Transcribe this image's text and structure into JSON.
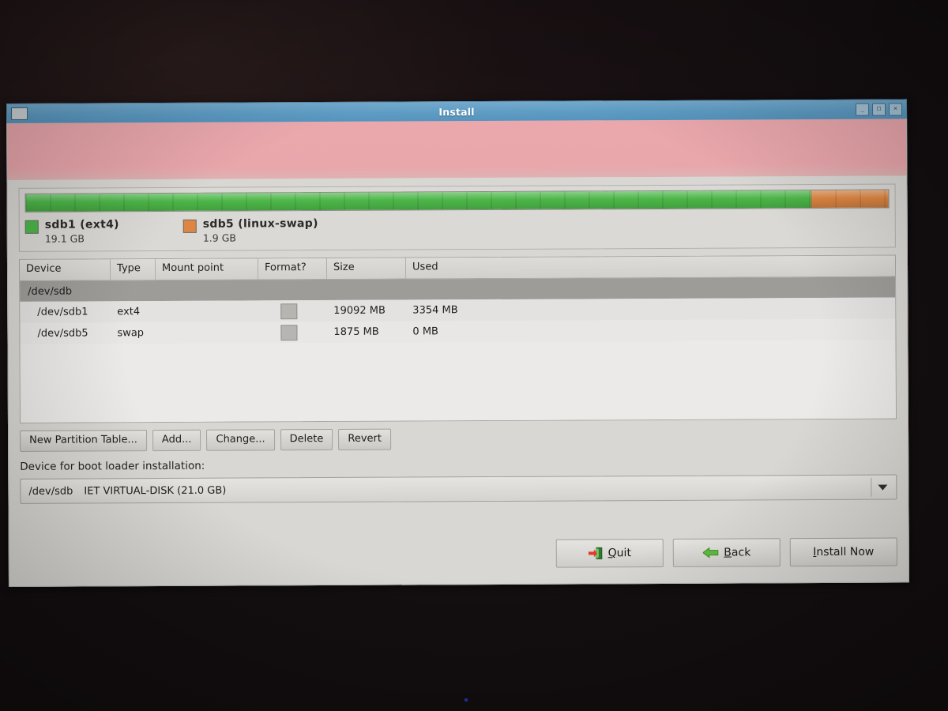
{
  "window": {
    "title": "Install",
    "menu_icon": "window-menu-icon",
    "buttons": [
      {
        "name": "minimize",
        "glyph": "_"
      },
      {
        "name": "maximize",
        "glyph": "□"
      },
      {
        "name": "close",
        "glyph": "✕"
      }
    ]
  },
  "partition_bar": {
    "segments": [
      {
        "label": "sdb1 (ext4)",
        "size_text": "19.1 GB",
        "color": "#4cb648",
        "percent": 91.0
      },
      {
        "label": "sdb5 (linux-swap)",
        "size_text": "1.9 GB",
        "color": "#dd8643",
        "percent": 9.0
      }
    ]
  },
  "table": {
    "columns": [
      "Device",
      "Type",
      "Mount point",
      "Format?",
      "Size",
      "Used"
    ],
    "groups": [
      {
        "label": "/dev/sdb",
        "rows": [
          {
            "device": "/dev/sdb1",
            "type": "ext4",
            "mount": "",
            "format": false,
            "size": "19092 MB",
            "used": "3354 MB"
          },
          {
            "device": "/dev/sdb5",
            "type": "swap",
            "mount": "",
            "format": false,
            "size": "1875 MB",
            "used": "0 MB"
          }
        ]
      }
    ]
  },
  "partition_actions": [
    {
      "name": "new-partition-table",
      "label": "New Partition Table..."
    },
    {
      "name": "add",
      "label": "Add..."
    },
    {
      "name": "change",
      "label": "Change..."
    },
    {
      "name": "delete",
      "label": "Delete"
    },
    {
      "name": "revert",
      "label": "Revert"
    }
  ],
  "bootloader": {
    "label": "Device for boot loader installation:",
    "selected_device": "/dev/sdb",
    "selected_description": "IET VIRTUAL-DISK (21.0 GB)",
    "arrow_icon": "chevron-down-icon"
  },
  "footer": {
    "quit": {
      "label_pre": "",
      "mnemonic": "Q",
      "label_post": "uit",
      "icon": "quit-door-icon"
    },
    "back": {
      "label_pre": "",
      "mnemonic": "B",
      "label_post": "ack",
      "icon": "arrow-left-icon"
    },
    "install": {
      "mnemonic": "I",
      "label_post": "nstall Now"
    }
  },
  "colors": {
    "titlebar": "#5e9cc4",
    "empty_canvas": "#e9a6ab",
    "window_bg": "#d9d7d3",
    "ext4_green": "#4cb648",
    "swap_orange": "#dd8643",
    "group_row": "#9e9c99"
  }
}
